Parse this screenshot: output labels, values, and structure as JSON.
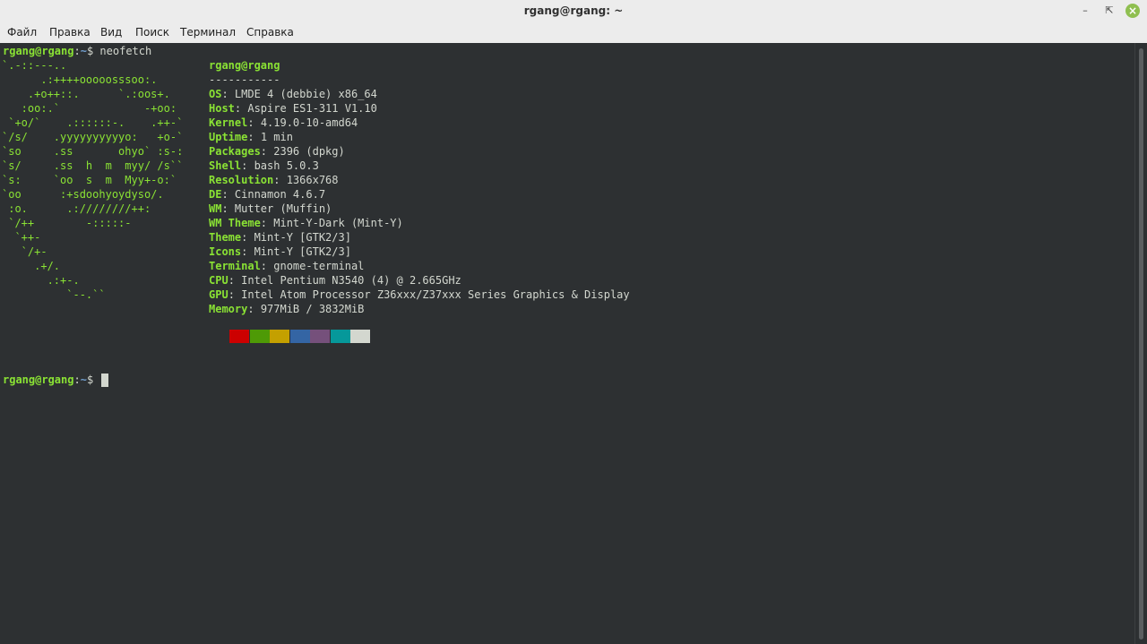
{
  "window": {
    "title": "rgang@rgang: ~"
  },
  "menu": [
    "Файл",
    "Правка",
    "Вид",
    "Поиск",
    "Терминал",
    "Справка"
  ],
  "prompt": {
    "user": "rgang@rgang",
    "path": "~",
    "symbol": "$",
    "command": "neofetch"
  },
  "logo_lines": [
    "`.-::---..",
    "      .:++++ooooosssoo:.",
    "    .+o++::.      `.:oos+.",
    "   :oo:.`             -+oo:",
    " `+o/`    .::::::-.    .++-`",
    "`/s/    .yyyyyyyyyyo:   +o-`",
    "`so     .ss       ohyo` :s-:",
    "`s/     .ss  h  m  myy/ /s``",
    "`s:     `oo  s  m  Myy+-o:`",
    "`oo      :+sdoohyoydyso/.",
    " :o.      .:////////++:",
    " `/++        -:::::-",
    "  `++-",
    "   `/+-",
    "     .+/.",
    "       .:+-.",
    "          `--.``"
  ],
  "info": {
    "title": "rgang@rgang",
    "separator": "-----------",
    "rows": [
      {
        "key": "OS",
        "value": "LMDE 4 (debbie) x86_64"
      },
      {
        "key": "Host",
        "value": "Aspire ES1-311 V1.10"
      },
      {
        "key": "Kernel",
        "value": "4.19.0-10-amd64"
      },
      {
        "key": "Uptime",
        "value": "1 min"
      },
      {
        "key": "Packages",
        "value": "2396 (dpkg)"
      },
      {
        "key": "Shell",
        "value": "bash 5.0.3"
      },
      {
        "key": "Resolution",
        "value": "1366x768"
      },
      {
        "key": "DE",
        "value": "Cinnamon 4.6.7"
      },
      {
        "key": "WM",
        "value": "Mutter (Muffin)"
      },
      {
        "key": "WM Theme",
        "value": "Mint-Y-Dark (Mint-Y)"
      },
      {
        "key": "Theme",
        "value": "Mint-Y [GTK2/3]"
      },
      {
        "key": "Icons",
        "value": "Mint-Y [GTK2/3]"
      },
      {
        "key": "Terminal",
        "value": "gnome-terminal"
      },
      {
        "key": "CPU",
        "value": "Intel Pentium N3540 (4) @ 2.665GHz"
      },
      {
        "key": "GPU",
        "value": "Intel Atom Processor Z36xxx/Z37xxx Series Graphics & Display"
      },
      {
        "key": "Memory",
        "value": "977MiB / 3832MiB"
      }
    ]
  },
  "palette": [
    "#cc0000",
    "#4e9a06",
    "#c4a000",
    "#3465a4",
    "#75507b",
    "#06989a",
    "#d3d7cf"
  ],
  "colors": {
    "terminal_bg": "#2d3032",
    "prompt_user": "#8ae234",
    "prompt_path": "#729fcf",
    "text": "#d3d7cf",
    "close_button": "#8fbf50"
  }
}
